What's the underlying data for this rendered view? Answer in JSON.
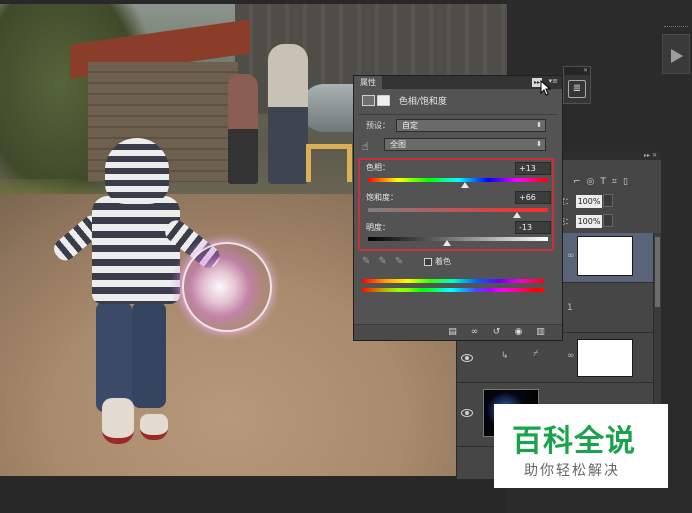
{
  "properties_panel": {
    "tab_label": "属性",
    "collapse_label": "▸▸",
    "menu_label": "▾≡",
    "adjustment_title": "色相/饱和度",
    "preset_label": "预设：",
    "preset_value": "自定",
    "channel_value": "全图",
    "hue": {
      "label": "色相：",
      "value": "+13",
      "level": 0.54
    },
    "saturation": {
      "label": "饱和度：",
      "value": "+66",
      "level": 0.83
    },
    "lightness": {
      "label": "明度：",
      "value": "-13",
      "level": 0.44
    },
    "colorize_label": "着色",
    "eyedroppers": [
      "eyedropper-icon",
      "eyedropper-plus-icon",
      "eyedropper-minus-icon"
    ],
    "bottom_icons": [
      "clip-to-layer-icon",
      "view-previous-state-icon",
      "reset-icon",
      "toggle-visibility-icon",
      "delete-icon"
    ]
  },
  "layers_panel": {
    "opacity_label": "度：",
    "opacity_value": "100%",
    "fill_label": "充：",
    "fill_value": "100%",
    "layer_icons": [
      "filter-pixel-icon",
      "filter-adjust-icon",
      "filter-type-icon",
      "filter-shape-icon",
      "filter-smart-icon"
    ]
  },
  "mini_panel": {
    "icon": "adjustments-icon",
    "close": "✕"
  },
  "collapsed_dock": {
    "icon": "expand-arrow-icon"
  },
  "watermark": {
    "title": "百科全说",
    "subtitle": "助你轻松解决"
  },
  "colors": {
    "panel_bg": "#535353",
    "highlight_border": "#c8303a",
    "watermark_green": "#19a34a"
  }
}
